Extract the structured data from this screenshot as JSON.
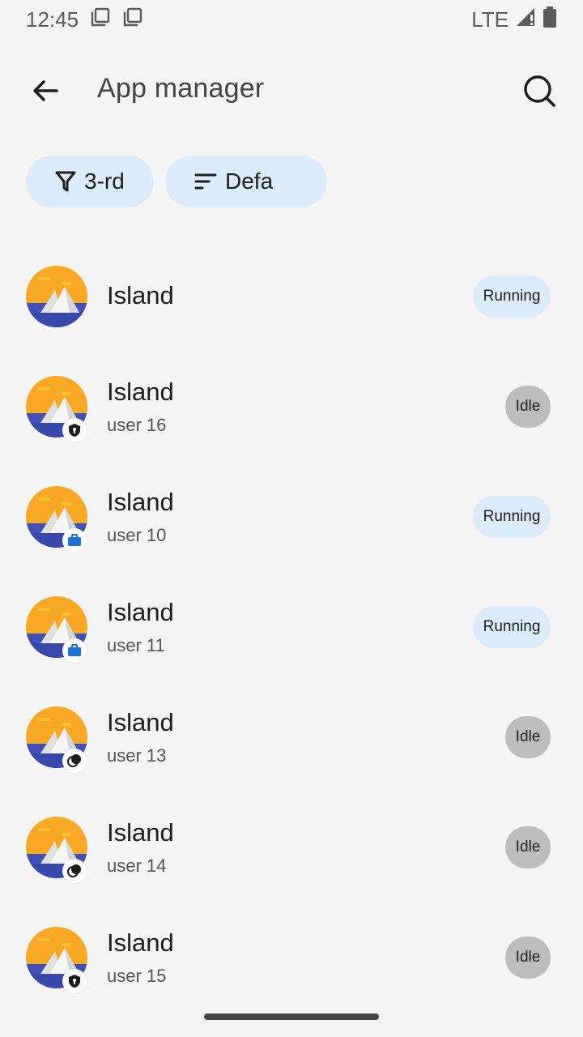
{
  "status_bar": {
    "time": "12:45",
    "network": "LTE"
  },
  "header": {
    "title": "App manager"
  },
  "chips": {
    "filter_label": "3-rd",
    "sort_label": "Defa"
  },
  "colors": {
    "chip_bg": "#dcebfb",
    "running_bg": "#dcebfb",
    "idle_bg": "#bdbdbd",
    "icon_sun": "#f9a825",
    "icon_sea": "#3f51b5"
  },
  "apps": [
    {
      "name": "Island",
      "user": "",
      "status": "Running",
      "badge": "none"
    },
    {
      "name": "Island",
      "user": "user 16",
      "status": "Idle",
      "badge": "shield-icon"
    },
    {
      "name": "Island",
      "user": "user 10",
      "status": "Running",
      "badge": "work-briefcase-icon"
    },
    {
      "name": "Island",
      "user": "user 11",
      "status": "Running",
      "badge": "work-briefcase-icon"
    },
    {
      "name": "Island",
      "user": "user 13",
      "status": "Idle",
      "badge": "circles-icon"
    },
    {
      "name": "Island",
      "user": "user 14",
      "status": "Idle",
      "badge": "circles-icon"
    },
    {
      "name": "Island",
      "user": "user 15",
      "status": "Idle",
      "badge": "shield-icon"
    }
  ]
}
